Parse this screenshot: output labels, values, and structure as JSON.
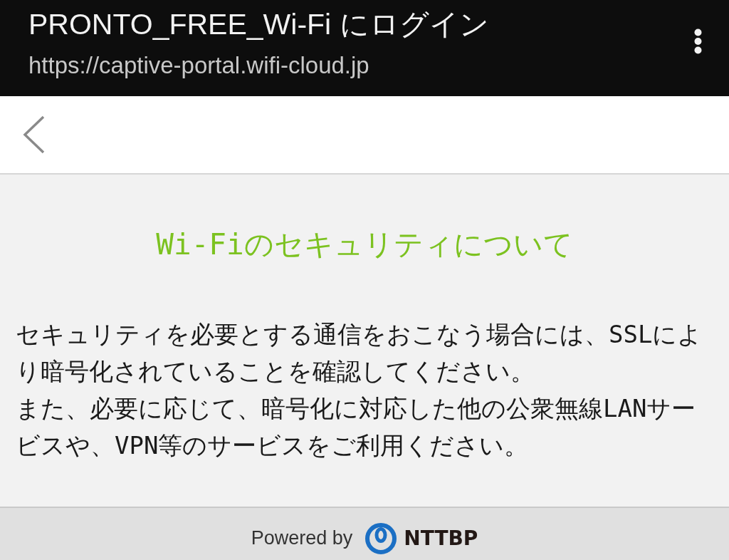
{
  "header": {
    "title": "PRONTO_FREE_Wi-Fi にログイン",
    "url": "https://captive-portal.wifi-cloud.jp"
  },
  "content": {
    "heading": "Wi-Fiのセキュリティについて",
    "paragraphs": [
      "セキュリティを必要とする通信をおこなう場合には、SSLにより暗号化されていることを確認してください。",
      "また、必要に応じて、暗号化に対応した他の公衆無線LANサービスや、VPN等のサービスをご利用ください。"
    ]
  },
  "footer": {
    "powered_by": "Powered by",
    "logo_text": "NTTBP"
  }
}
